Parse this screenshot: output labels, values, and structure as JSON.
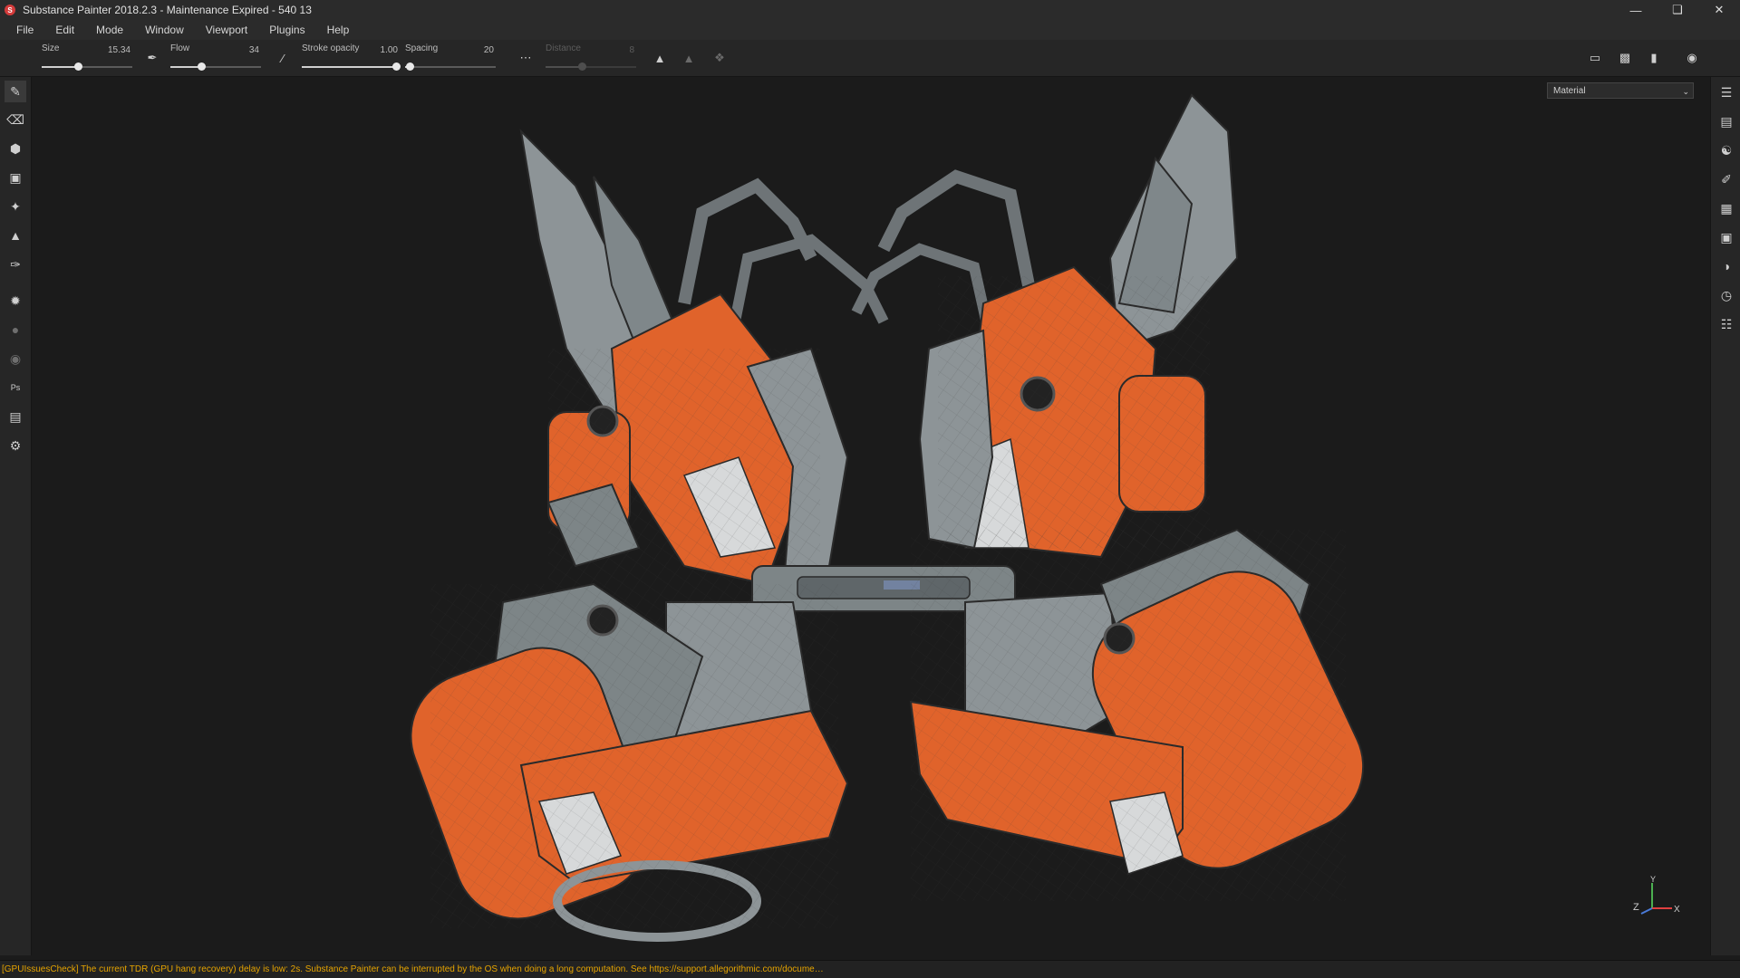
{
  "window": {
    "title": "Substance Painter 2018.2.3 - Maintenance Expired - 540 13",
    "icon": "substance-painter-logo"
  },
  "menu": [
    "File",
    "Edit",
    "Mode",
    "Window",
    "Viewport",
    "Plugins",
    "Help"
  ],
  "tool_options": {
    "size": {
      "label": "Size",
      "value": "15.34",
      "fraction": 0.4
    },
    "flow": {
      "label": "Flow",
      "value": "34",
      "fraction": 0.34
    },
    "stroke_opacity": {
      "label": "Stroke opacity",
      "value": "1.00",
      "fraction": 1.0
    },
    "spacing": {
      "label": "Spacing",
      "value": "20",
      "fraction": 0.05
    },
    "distance": {
      "label": "Distance",
      "value": "8",
      "fraction": 0.4,
      "enabled": false
    }
  },
  "viewport": {
    "channel": "Material",
    "gizmo_axes": [
      "Z",
      "X",
      "Y"
    ]
  },
  "left_tools": [
    "paint-brush-icon",
    "eraser-icon",
    "projection-icon",
    "polygon-fill-icon",
    "smudge-icon",
    "clone-stamp-icon",
    "color-picker-icon",
    "bake-icon",
    "bell-icon",
    "sphere-icon",
    "photoshop-icon",
    "export-icon",
    "settings-icon"
  ],
  "right_panels": [
    "layers-list-icon",
    "texture-set-icon",
    "layers-stack-icon",
    "brush-properties-icon",
    "uv-grid-icon",
    "display-settings-icon",
    "shader-icon",
    "history-icon",
    "log-icon"
  ],
  "status_message": "[GPUIssuesCheck] The current TDR (GPU hang recovery) delay is low: 2s. Substance Painter can be interrupted by the OS when doing a long computation. See https://support.allegorithmic.com/docume…",
  "colors": {
    "mech_orange": "#e0632b",
    "mech_grey": "#8d9497",
    "status_warning": "#e6a400",
    "background": "#1b1b1b"
  }
}
